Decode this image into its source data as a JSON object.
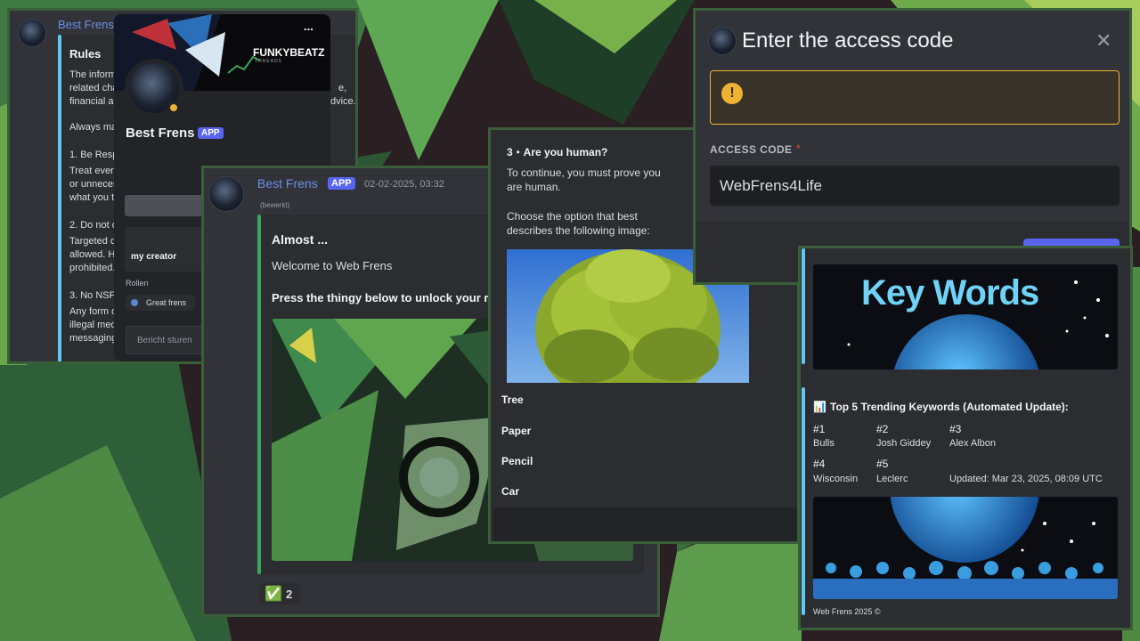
{
  "rules_panel": {
    "author": "Best Frens",
    "title": "Rules",
    "lines": [
      "The inform",
      "related cha",
      "financial ac",
      "Always mak",
      "1. Be Respe",
      "Treat every",
      "or unneces",
      "what you th",
      "2. Do not c",
      "Targeted cu",
      "allowed. Ho",
      "prohibited.",
      "3. No NSFW",
      "Any form o",
      "illegal med",
      "messaging"
    ],
    "overflow_right": [
      ", ",
      "e,",
      "dvice."
    ]
  },
  "profile_popup": {
    "brand_text": "FUNKYBEATZ",
    "brand_sub": "THREADS",
    "more_label": "...",
    "name": "Best Frens",
    "badge": "APP",
    "field_label": "my creator",
    "roles_title": "Rollen",
    "role": "Great frens",
    "message_placeholder": "Bericht sturen"
  },
  "message_panel": {
    "author": "Best Frens",
    "badge": "APP",
    "timestamp": "02-02-2025, 03:32",
    "edited": "(bewerkt)",
    "embed_title": "Almost ...",
    "embed_desc": "Welcome to Web Frens",
    "embed_bold": "Press the thingy below to unlock your r",
    "reaction_emoji": "✅",
    "reaction_count": "2"
  },
  "captcha_panel": {
    "title": "3・Are you human?",
    "p1": "To continue, you must prove you are human.",
    "p2": "Choose the option that best describes the following image:",
    "options": [
      "Tree",
      "Paper",
      "Pencil",
      "Car"
    ]
  },
  "access_modal": {
    "title": "Enter the access code",
    "close_label": "✕",
    "warning_icon": "!",
    "field_label": "ACCESS CODE",
    "required_mark": "*",
    "field_value": "WebFrens4Life"
  },
  "keywords_panel": {
    "banner_text": "Key Words",
    "heading": "Top 5 Trending Keywords (Automated Update):",
    "chart_icon": "📊",
    "items": [
      {
        "rank": "#1",
        "word": "Bulls"
      },
      {
        "rank": "#2",
        "word": "Josh Giddey"
      },
      {
        "rank": "#3",
        "word": "Alex Albon"
      },
      {
        "rank": "#4",
        "word": "Wisconsin"
      },
      {
        "rank": "#5",
        "word": "Leclerc"
      }
    ],
    "updated": "Updated: Mar 23, 2025, 08:09 UTC",
    "footer": "Web Frens 2025 ©"
  },
  "colors": {
    "accent_green": "#3ba55c",
    "blurple": "#5865f2",
    "warning": "#f0b232",
    "panel_border": "#3b5e3a"
  }
}
